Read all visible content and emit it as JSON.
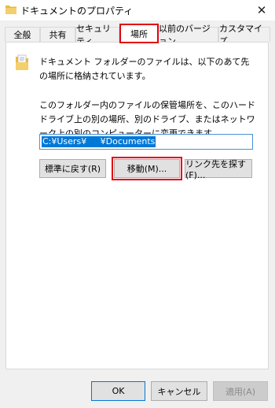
{
  "window": {
    "title": "ドキュメントのプロパティ",
    "close_glyph": "✕"
  },
  "tabs": [
    {
      "label": "全般",
      "active": false
    },
    {
      "label": "共有",
      "active": false
    },
    {
      "label": "セキュリティ",
      "active": false
    },
    {
      "label": "場所",
      "active": true
    },
    {
      "label": "以前のバージョン",
      "active": false
    },
    {
      "label": "カスタマイズ",
      "active": false
    }
  ],
  "location_tab": {
    "description_1": "ドキュメント フォルダーのファイルは、以下のあて先の場所に格納されています。",
    "description_2": "このフォルダー内のファイルの保管場所を、このハード ドライブ上の別の場所、別のドライブ、またはネットワーク上の別のコンピューターに変更できます。",
    "path_value": "C:¥Users¥     ¥Documents",
    "restore_default_label": "標準に戻す(R)",
    "move_label": "移動(M)...",
    "find_target_label": "リンク先を探す(F)..."
  },
  "footer": {
    "ok_label": "OK",
    "cancel_label": "キャンセル",
    "apply_label": "適用(A)"
  },
  "colors": {
    "highlight_frame": "#e2000f",
    "selection": "#0078d7"
  },
  "icons": {
    "title": "folder-icon",
    "close": "close-icon",
    "content": "documents-folder-icon"
  }
}
